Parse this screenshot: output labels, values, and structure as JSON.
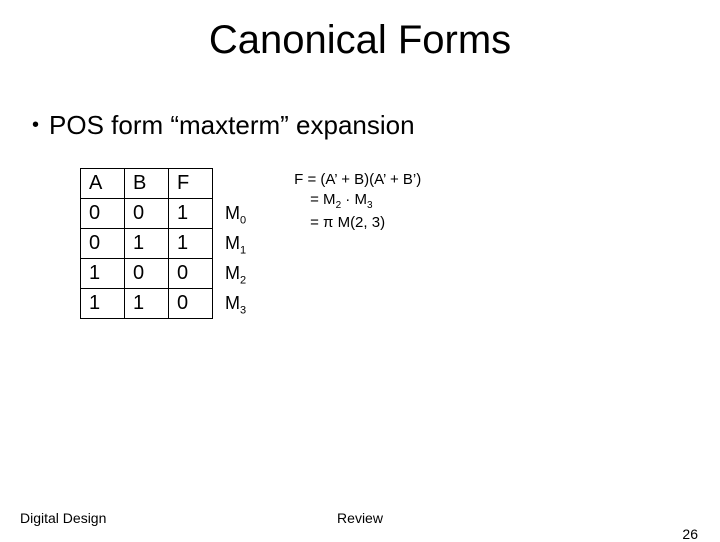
{
  "title": "Canonical Forms",
  "bullet": "POS form “maxterm” expansion",
  "table": {
    "header": {
      "a": "A",
      "b": "B",
      "f": "F"
    },
    "rows": [
      {
        "a": "0",
        "b": "0",
        "f": "1",
        "m": "M",
        "idx": "0"
      },
      {
        "a": "0",
        "b": "1",
        "f": "1",
        "m": "M",
        "idx": "1"
      },
      {
        "a": "1",
        "b": "0",
        "f": "0",
        "m": "M",
        "idx": "2"
      },
      {
        "a": "1",
        "b": "1",
        "f": "0",
        "m": "M",
        "idx": "3"
      }
    ]
  },
  "eq": {
    "line1_pre": "F = (A’ + B)(A’ + B’)",
    "line2_pre": "= M",
    "line2_s1": "2",
    "line2_mid": " · M",
    "line2_s2": "3",
    "line3": "= π M(2, 3)"
  },
  "footer": {
    "left": "Digital Design",
    "center": "Review",
    "right": "26"
  }
}
